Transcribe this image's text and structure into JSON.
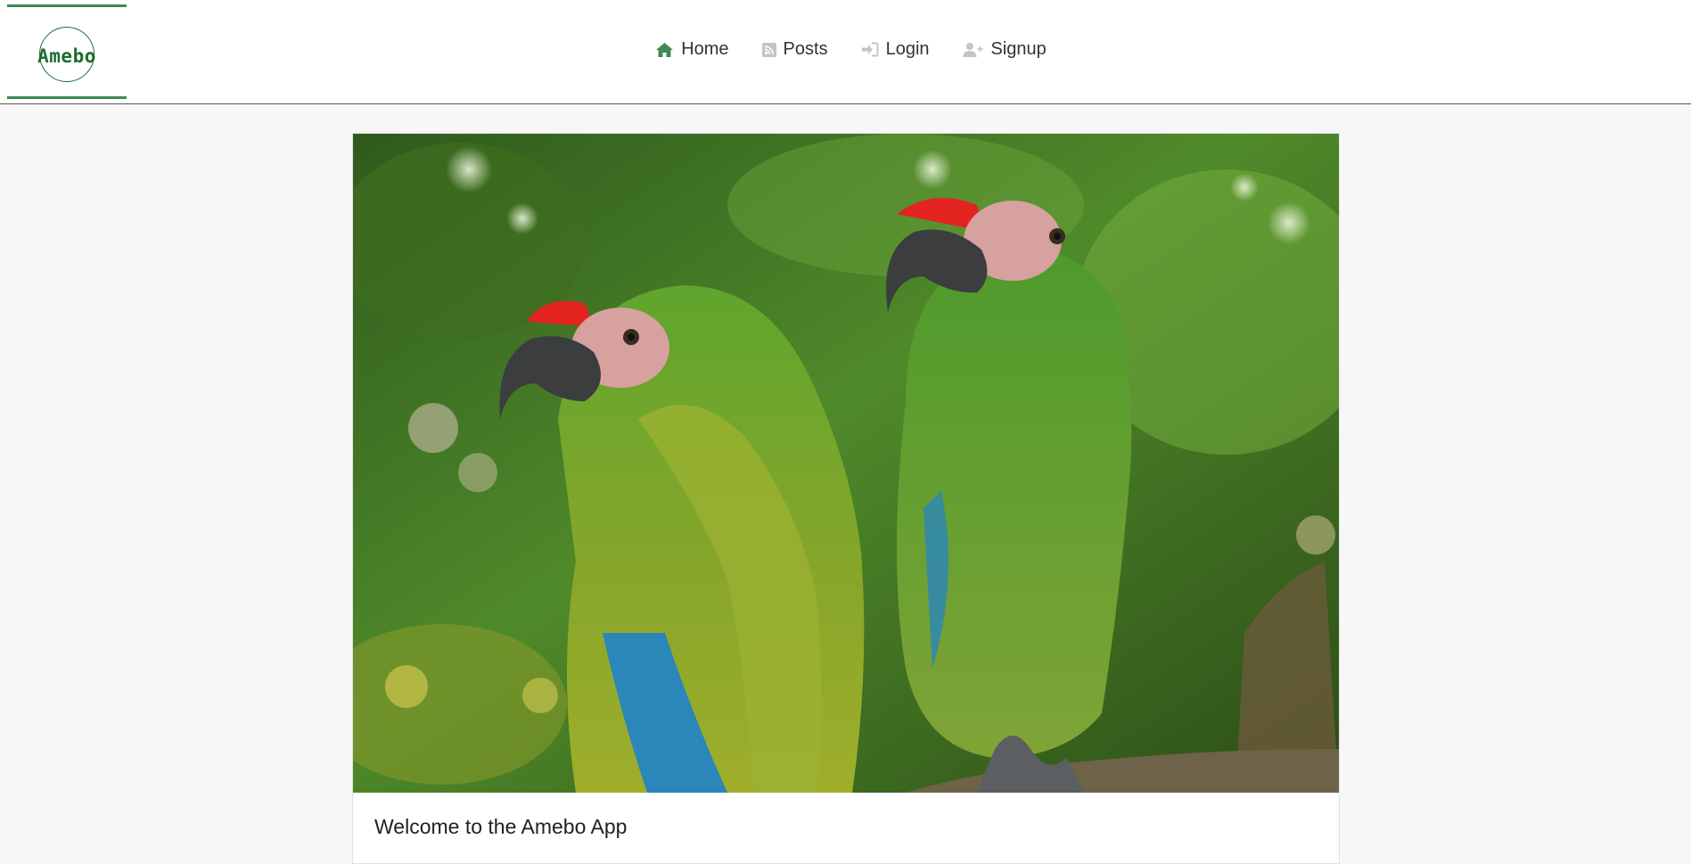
{
  "header": {
    "logo_text": "Amebo",
    "nav": [
      {
        "label": "Home",
        "icon": "home-icon"
      },
      {
        "label": "Posts",
        "icon": "rss-icon"
      },
      {
        "label": "Login",
        "icon": "sign-in-icon"
      },
      {
        "label": "Signup",
        "icon": "user-plus-icon"
      }
    ]
  },
  "colors": {
    "accent": "#3f8a52",
    "logo": "#1d6b2e",
    "nav_icon": "#c4c4c4",
    "page_bg": "#f7f7f7"
  },
  "hero": {
    "image_subject": "two green macaw parrots perched on a branch"
  },
  "card": {
    "title": "Welcome to the Amebo App"
  }
}
